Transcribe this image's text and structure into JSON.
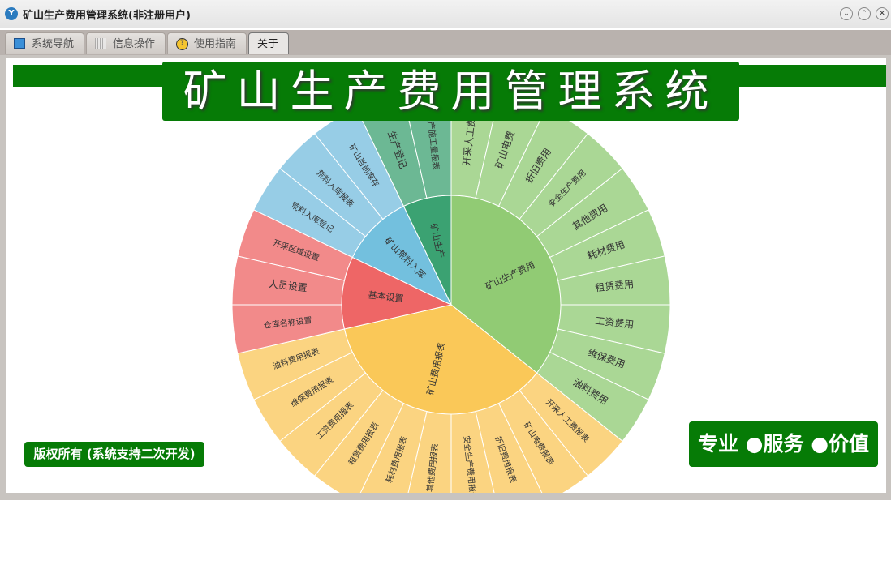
{
  "window": {
    "title": "矿山生产费用管理系统(非注册用户)"
  },
  "tabs": [
    {
      "label": "系统导航",
      "icon": "monitor-icon"
    },
    {
      "label": "信息操作",
      "icon": "grid-icon"
    },
    {
      "label": "使用指南",
      "icon": "help-icon"
    },
    {
      "label": "关于",
      "active": true
    }
  ],
  "banner": {
    "title": "矿山生产费用管理系统"
  },
  "footer": {
    "copyright": "版权所有 (系统支持二次开发)",
    "slogan": "专业 ●服务 ●价值"
  },
  "chart_data": {
    "type": "sunburst",
    "groups": [
      {
        "name": "矿山生产费用",
        "color": "#91cb74",
        "leafColor": "#aad795",
        "children": [
          "开采人工费",
          "矿山电费",
          "折旧费用",
          "安全生产费用",
          "其他费用",
          "耗材费用",
          "租赁费用",
          "工资费用",
          "维保费用",
          "油料费用"
        ]
      },
      {
        "name": "矿山费用报表",
        "color": "#fac858",
        "leafColor": "#fbd481",
        "children": [
          "开采人工费报表",
          "矿山电费报表",
          "折旧费用报表",
          "安全生产费用报表",
          "其他费用报表",
          "耗材费用报表",
          "租赁费用报表",
          "工资费用报表",
          "维保费用报表",
          "油料费用报表"
        ]
      },
      {
        "name": "基本设置",
        "color": "#ee6666",
        "leafColor": "#f28a8a",
        "children": [
          "仓库名称设置",
          "人员设置",
          "开采区域设置"
        ]
      },
      {
        "name": "矿山荒料入库",
        "color": "#73c0de",
        "leafColor": "#97cde6",
        "children": [
          "荒料入库登记",
          "荒料入库报表",
          "矿山当前库存"
        ]
      },
      {
        "name": "矿山生产",
        "color": "#3ba272",
        "leafColor": "#6cb894",
        "children": [
          "生产登记",
          "生产施工量报表"
        ]
      }
    ]
  }
}
